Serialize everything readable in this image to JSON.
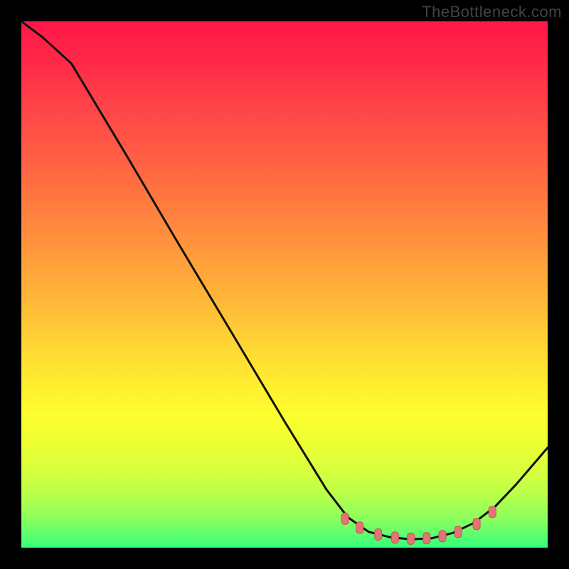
{
  "watermark": "TheBottleneck.com",
  "chart_data": {
    "type": "line",
    "title": "",
    "xlabel": "",
    "ylabel": "",
    "x_range": [
      0.0,
      1.0
    ],
    "y_range": [
      0.0,
      1.0
    ],
    "series": [
      {
        "name": "curve",
        "x": [
          0.0,
          0.04,
          0.095,
          0.2,
          0.3,
          0.4,
          0.5,
          0.58,
          0.62,
          0.66,
          0.7,
          0.74,
          0.78,
          0.82,
          0.86,
          0.9,
          0.94,
          1.0
        ],
        "y": [
          1.0,
          0.97,
          0.92,
          0.745,
          0.575,
          0.408,
          0.24,
          0.11,
          0.058,
          0.03,
          0.02,
          0.016,
          0.018,
          0.028,
          0.047,
          0.078,
          0.12,
          0.19
        ]
      }
    ],
    "markers": {
      "name": "highlight-band",
      "x": [
        0.615,
        0.643,
        0.678,
        0.71,
        0.74,
        0.77,
        0.8,
        0.83,
        0.865,
        0.895
      ],
      "y": [
        0.055,
        0.038,
        0.025,
        0.019,
        0.017,
        0.018,
        0.022,
        0.03,
        0.045,
        0.068
      ]
    },
    "gradient_stops": [
      {
        "pos": 0.0,
        "color": "#ff1749"
      },
      {
        "pos": 0.5,
        "color": "#ffbe37"
      },
      {
        "pos": 0.75,
        "color": "#fcff2e"
      },
      {
        "pos": 1.0,
        "color": "#35ff7e"
      }
    ]
  }
}
